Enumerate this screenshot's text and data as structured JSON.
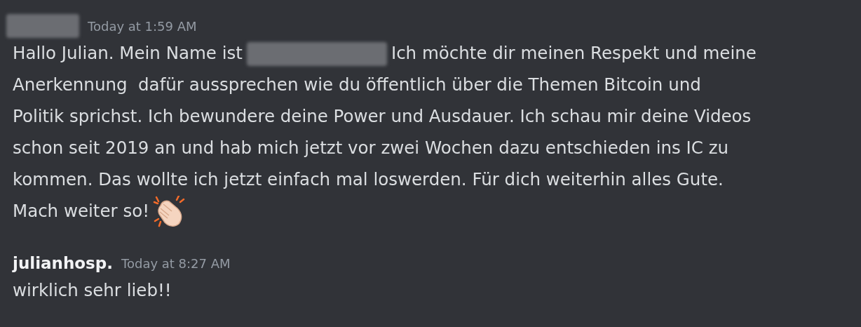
{
  "messages": [
    {
      "author": {
        "redacted": true
      },
      "timestamp": "Today at 1:59 AM",
      "lines": [
        [
          {
            "kind": "text",
            "text": "Hallo Julian. Mein Name ist"
          },
          {
            "kind": "redacted"
          },
          {
            "kind": "text",
            "text": "Ich möchte dir meinen Respekt und meine"
          }
        ],
        [
          {
            "kind": "text",
            "text": "Anerkennung  dafür aussprechen wie du öffentlich über die Themen Bitcoin und"
          }
        ],
        [
          {
            "kind": "text",
            "text": "Politik sprichst. Ich bewundere deine Power und Ausdauer. Ich schau mir deine Videos"
          }
        ],
        [
          {
            "kind": "text",
            "text": "schon seit 2019 an und hab mich jetzt vor zwei Wochen dazu entschieden ins IC zu"
          }
        ],
        [
          {
            "kind": "text",
            "text": "kommen. Das wollte ich jetzt einfach mal loswerden. Für dich weiterhin alles Gute."
          }
        ],
        [
          {
            "kind": "text",
            "text": "Mach weiter so!"
          },
          {
            "kind": "emoji"
          }
        ]
      ]
    },
    {
      "author": {
        "name": "julianhosp."
      },
      "timestamp": "Today at 8:27 AM",
      "lines": [
        [
          {
            "kind": "text",
            "text": "wirklich sehr lieb!!"
          }
        ]
      ]
    }
  ]
}
